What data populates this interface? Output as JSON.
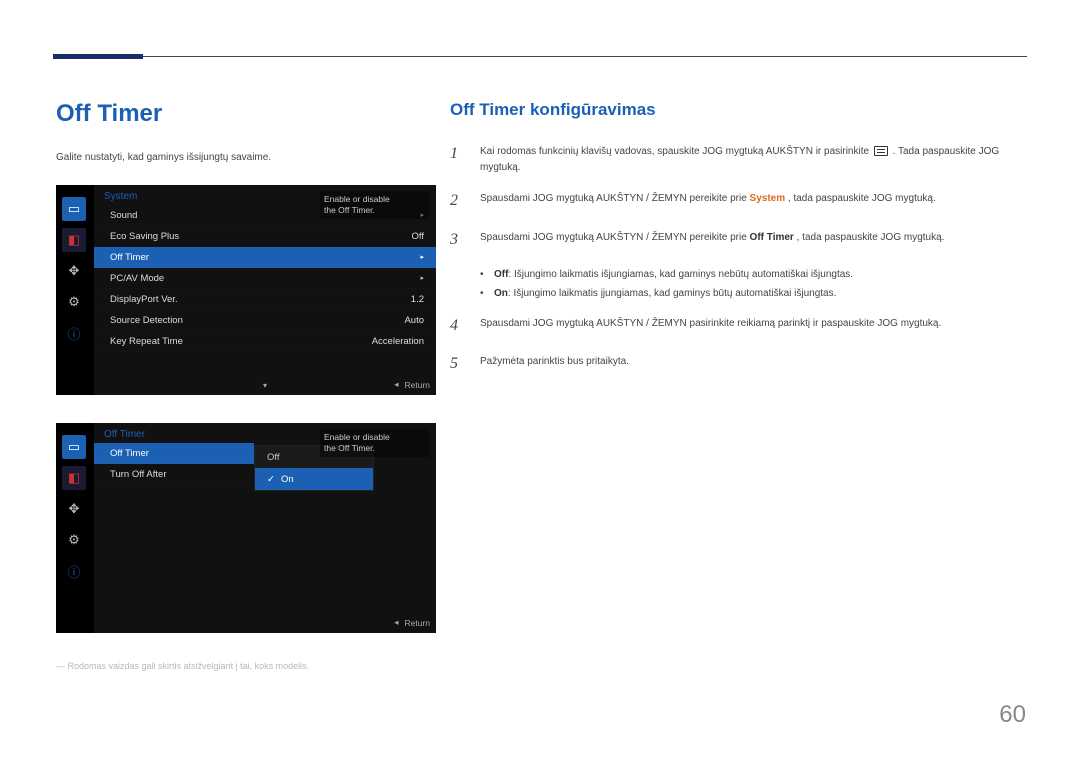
{
  "page_number": "60",
  "left": {
    "heading": "Off Timer",
    "intro": "Galite nustatyti, kad gaminys išsijungtų savaime.",
    "footnote": "― Rodomas vaizdas gali skirtis atsižvelgiant į tai, koks modelis."
  },
  "osd1": {
    "title": "System",
    "tip_line1": "Enable or disable",
    "tip_line2": "the Off Timer.",
    "rows": [
      {
        "label": "Sound",
        "value": "▸"
      },
      {
        "label": "Eco Saving Plus",
        "value": "Off"
      },
      {
        "label": "Off Timer",
        "value": "▸"
      },
      {
        "label": "PC/AV Mode",
        "value": "▸"
      },
      {
        "label": "DisplayPort Ver.",
        "value": "1.2"
      },
      {
        "label": "Source Detection",
        "value": "Auto"
      },
      {
        "label": "Key Repeat Time",
        "value": "Acceleration"
      }
    ],
    "footer_down": "▾",
    "footer_return_glyph": "◂",
    "footer_return": "Return"
  },
  "osd2": {
    "title": "Off Timer",
    "tip_line1": "Enable or disable",
    "tip_line2": "the Off Timer.",
    "rows": [
      {
        "label": "Off Timer",
        "value": "Off"
      },
      {
        "label": "Turn Off After",
        "value": ""
      }
    ],
    "options": [
      {
        "label": "Off"
      },
      {
        "label": "On",
        "check": "✓"
      }
    ],
    "footer_return_glyph": "◂",
    "footer_return": "Return"
  },
  "right": {
    "heading": "Off Timer konfigūravimas",
    "steps": {
      "s1a": "Kai rodomas funkcinių klavišų vadovas, spauskite JOG mygtuką AUKŠTYN ir pasirinkite ",
      "s1b": ". Tada paspauskite JOG mygtuką.",
      "s2a": "Spausdami JOG mygtuką AUKŠTYN / ŽEMYN pereikite prie ",
      "s2_system": "System",
      "s2b": ", tada paspauskite JOG mygtuką.",
      "s3a": "Spausdami JOG mygtuką AUKŠTYN / ŽEMYN pereikite prie ",
      "s3_offtimer": "Off Timer",
      "s3b": ", tada paspauskite JOG mygtuką.",
      "b1_label": "Off",
      "b1_text": ": Išjungimo laikmatis išjungiamas, kad gaminys nebūtų automatiškai išjungtas.",
      "b2_label": "On",
      "b2_text": ": Išjungimo laikmatis įjungiamas, kad gaminys būtų automatiškai išjungtas.",
      "s4": "Spausdami JOG mygtuką AUKŠTYN / ŽEMYN pasirinkite reikiamą parinktį ir paspauskite JOG mygtuką.",
      "s5": "Pažymėta parinktis bus pritaikyta."
    }
  },
  "icons": {
    "monitor": "▭",
    "adj": "◧",
    "target": "✥",
    "gear": "⚙",
    "info": "ⓘ"
  }
}
